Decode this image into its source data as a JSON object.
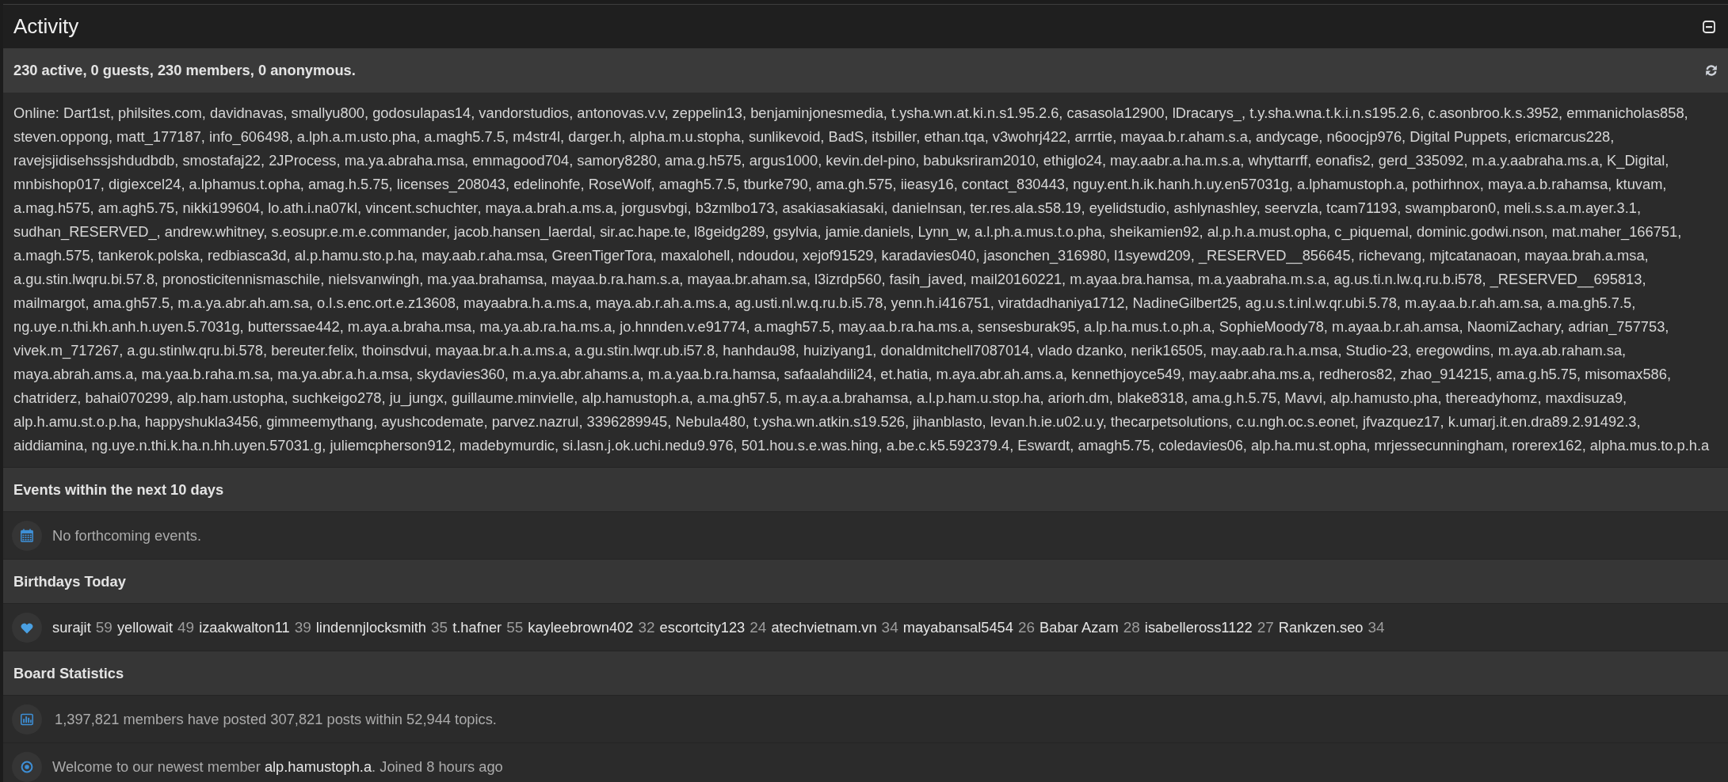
{
  "panel": {
    "title": "Activity"
  },
  "summary": {
    "text": "230 active, 0 guests, 230 members, 0 anonymous."
  },
  "online": {
    "text": "Online: Dart1st, philsites.com, davidnavas, smallyu800, godosulapas14, vandorstudios, antonovas.v.v, zeppelin13, benjaminjonesmedia, t.ysha.wn.at.ki.n.s1.95.2.6, casasola12900, lDracarys_, t.y.sha.wna.t.k.i.n.s195.2.6, c.asonbroo.k.s.3952, emmanicholas858, steven.oppong, matt_177187, info_606498, a.lph.a.m.usto.pha, a.magh5.7.5, m4str4l, darger.h, alpha.m.u.stopha, sunlikevoid, BadS, itsbiller, ethan.tqa, v3wohrj422, arrrtie, mayaa.b.r.aham.s.a, andycage, n6oocjp976, Digital Puppets, ericmarcus228, ravejsjidisehssjshdudbdb, smostafaj22, 2JProcess, ma.ya.abraha.msa, emmagood704, samory8280, ama.g.h575, argus1000, kevin.del-pino, babuksriram2010, ethiglo24, may.aabr.a.ha.m.s.a, whyttarrff, eonafis2, gerd_335092, m.a.y.aabraha.ms.a, K_Digital, mnbishop017, digiexcel24, a.lphamus.t.opha, amag.h.5.75, licenses_208043, edelinohfe, RoseWolf, amagh5.7.5, tburke790, ama.gh.575, iieasy16, contact_830443, nguy.ent.h.ik.hanh.h.uy.en57031g, a.lphamustoph.a, pothirhnox, maya.a.b.rahamsa, ktuvam, a.mag.h575, am.agh5.75, nikki199604, lo.ath.i.na07kl, vincent.schuchter, maya.a.brah.a.ms.a, jorgusvbgi, b3zmlbo173, asakiasakiasaki, danielnsan, ter.res.ala.s58.19, eyelidstudio, ashlynashley, seervzla, tcam71193, swampbaron0, meli.s.s.a.m.ayer.3.1, sudhan_RESERVED_, andrew.whitney, s.eosupr.e.m.e.commander, jacob.hansen_laerdal, sir.ac.hape.te, l8geidg289, gsylvia, jamie.daniels, Lynn_w, a.l.ph.a.mus.t.o.pha, sheikamien92, al.p.h.a.must.opha, c_piquemal, dominic.godwi.nson, mat.maher_166751, a.magh.575, tankerok.polska, redbiasca3d, al.p.hamu.sto.p.ha, may.aab.r.aha.msa, GreenTigerTora, maxalohell, ndoudou, xejof91529, karadavies040, jasonchen_316980, l1syewd209, _RESERVED__856645, richevang, mjtcatanaoan, mayaa.brah.a.msa, a.gu.stin.lwqru.bi.57.8, pronosticitennismaschile, nielsvanwingh, ma.yaa.brahamsa, mayaa.b.ra.ham.s.a, mayaa.br.aham.sa, l3izrdp560, fasih_javed, mail20160221, m.ayaa.bra.hamsa, m.a.yaabraha.m.s.a, ag.us.ti.n.lw.q.ru.b.i578, _RESERVED__695813, mailmargot, ama.gh57.5, m.a.ya.abr.ah.am.sa, o.l.s.enc.ort.e.z13608, mayaabra.h.a.ms.a, maya.ab.r.ah.a.ms.a, ag.usti.nl.w.q.ru.b.i5.78, yenn.h.i416751, viratdadhaniya1712, NadineGilbert25, ag.u.s.t.inl.w.qr.ubi.5.78, m.ay.aa.b.r.ah.am.sa, a.ma.gh5.7.5, ng.uye.n.thi.kh.anh.h.uyen.5.7031g, butterssae442, m.aya.a.braha.msa, ma.ya.ab.ra.ha.ms.a, jo.hnnden.v.e91774, a.magh57.5, may.aa.b.ra.ha.ms.a, sensesburak95, a.lp.ha.mus.t.o.ph.a, SophieMoody78, m.ayaa.b.r.ah.amsa, NaomiZachary, adrian_757753, vivek.m_717267, a.gu.stinlw.qru.bi.578, bereuter.felix, thoinsdvui, mayaa.br.a.h.a.ms.a, a.gu.stin.lwqr.ub.i57.8, hanhdau98, huiziyang1, donaldmitchell7087014, vlado dzanko, nerik16505, may.aab.ra.h.a.msa, Studio-23, eregowdins, m.aya.ab.raham.sa, maya.abrah.ams.a, ma.yaa.b.raha.m.sa, ma.ya.abr.a.h.a.msa, skydavies360, m.a.ya.abr.ahams.a, m.a.yaa.b.ra.hamsa, safaalahdili24, et.hatia, m.aya.abr.ah.ams.a, kennethjoyce549, may.aabr.aha.ms.a, redheros82, zhao_914215, ama.g.h5.75, misomax586, chatriderz, bahai070299, alp.ham.ustopha, suchkeigo278, ju_jungx, guillaume.minvielle, alp.hamustoph.a, a.ma.gh57.5, m.ay.a.a.brahamsa, a.l.p.ham.u.stop.ha, ariorh.dm, blake8318, ama.g.h.5.75, Mavvi, alp.hamusto.pha, thereadyhomz, maxdisuza9, alp.h.amu.st.o.p.ha, happyshukla3456, gimmeemythang, ayushcodemate, parvez.nazrul, 3396289945, Nebula480, t.ysha.wn.atkin.s19.526, jihanblasto, levan.h.ie.u02.u.y, thecarpetsolutions, c.u.ngh.oc.s.eonet, jfvazquez17, k.umarj.it.en.dra89.2.91492.3, aiddiamina, ng.uye.n.thi.k.ha.n.hh.uyen.57031.g, juliemcpherson912, madebymurdic, si.lasn.j.ok.uchi.nedu9.976, 501.hou.s.e.was.hing, a.be.c.k5.592379.4, Eswardt, amagh5.75, coledavies06, alp.ha.mu.st.opha, mrjessecunningham, rorerex162, alpha.mus.to.p.h.a"
  },
  "sections": [
    {
      "title": "Events within the next 10 days",
      "rows": [
        {
          "kind": "events",
          "text": "No forthcoming events."
        }
      ]
    },
    {
      "title": "Birthdays Today",
      "rows": [
        {
          "kind": "birthdays",
          "people": [
            {
              "name": "surajit",
              "age": "59"
            },
            {
              "name": "yellowait",
              "age": "49"
            },
            {
              "name": "izaakwalton11",
              "age": "39"
            },
            {
              "name": "lindennjlocksmith",
              "age": "35"
            },
            {
              "name": "t.hafner",
              "age": "55"
            },
            {
              "name": "kayleebrown402",
              "age": "32"
            },
            {
              "name": "escortcity123",
              "age": "24"
            },
            {
              "name": "atechvietnam.vn",
              "age": "34"
            },
            {
              "name": "mayabansal5454",
              "age": "26"
            },
            {
              "name": "Babar Azam",
              "age": "28"
            },
            {
              "name": "isabelleross1122",
              "age": "27"
            },
            {
              "name": "Rankzen.seo",
              "age": "34"
            }
          ]
        }
      ]
    },
    {
      "title": "Board Statistics",
      "rows": [
        {
          "kind": "statistics",
          "text": "1,397,821 members have posted 307,821 posts within 52,944 topics."
        },
        {
          "kind": "newest_member",
          "before": "Welcome to our newest member",
          "name": "alp.hamustoph.a",
          "after": ". Joined 8 hours ago"
        }
      ]
    }
  ]
}
